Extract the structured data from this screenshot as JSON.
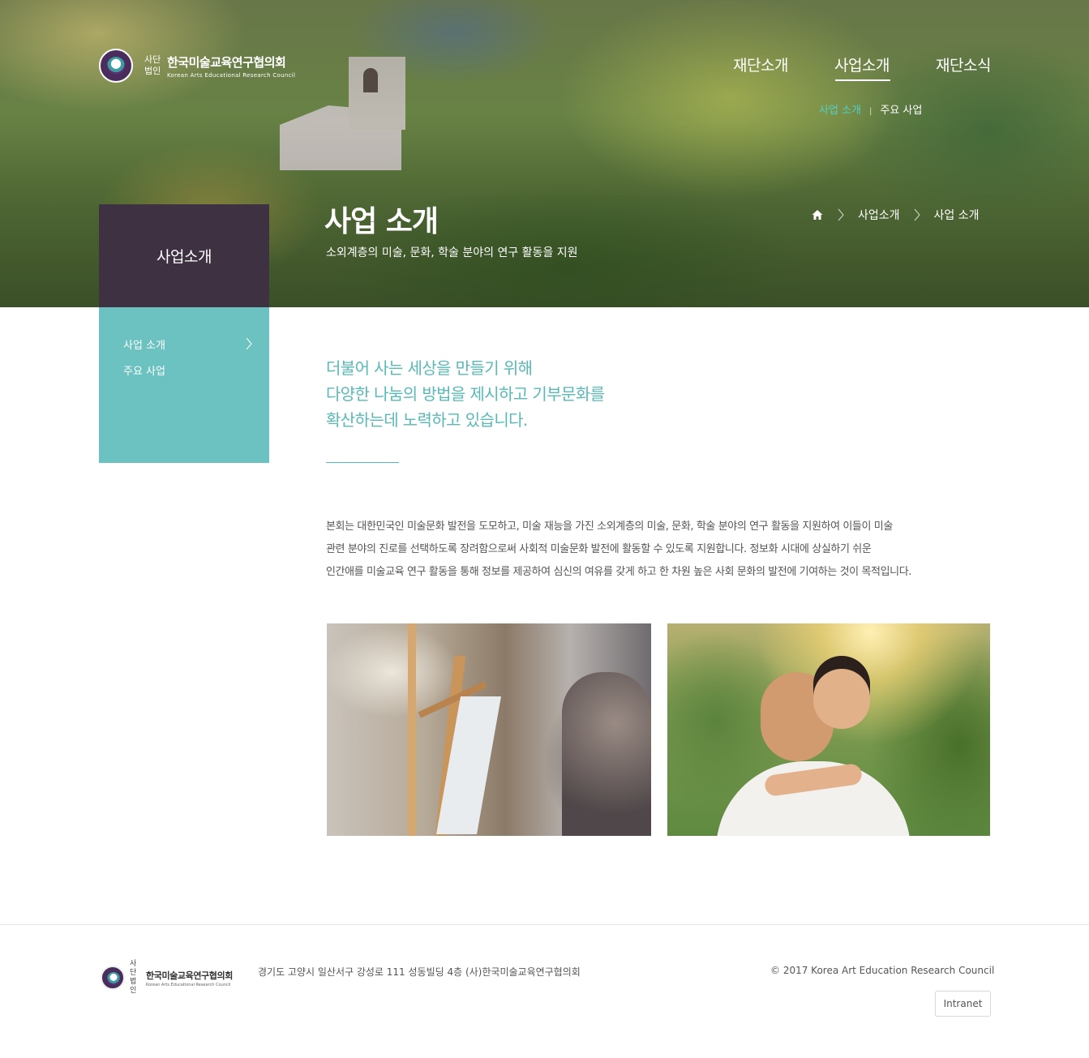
{
  "header": {
    "logo": {
      "small_label": "사단 법인",
      "name": "한국미술교육연구협의회",
      "english": "Korean Arts Educational Research Council"
    },
    "gnb": [
      {
        "label": "재단소개",
        "active": false
      },
      {
        "label": "사업소개",
        "active": true
      },
      {
        "label": "재단소식",
        "active": false
      }
    ],
    "subnav": [
      {
        "label": "사업 소개",
        "active": true
      },
      {
        "label": "주요 사업",
        "active": false
      }
    ]
  },
  "hero": {
    "title": "사업 소개",
    "subtitle": "소외계층의 미술, 문화, 학술 분야의 연구 활동을 지원",
    "breadcrumb": [
      "사업소개",
      "사업 소개"
    ]
  },
  "lnb": {
    "title": "사업소개",
    "items": [
      {
        "label": "사업 소개",
        "active": true
      },
      {
        "label": "주요 사업",
        "active": false
      }
    ]
  },
  "content": {
    "lead_lines": [
      "더불어 사는 세상을 만들기 위해",
      "다양한 나눔의 방법을 제시하고 기부문화를",
      "확산하는데 노력하고 있습니다."
    ],
    "body_lines": [
      "본회는 대한민국인 미술문화 발전을 도모하고, 미술 재능을 가진 소외계층의 미술, 문화, 학술 분야의 연구 활동을 지원하여 이들이 미술",
      "관련 분야의 진로를 선택하도록 장려함으로써 사회적 미술문화 발전에 활동할 수 있도록 지원합니다. 정보화 시대에 상실하기 쉬운",
      "인간애를 미술교육 연구 활동을 통해 정보를 제공하여 심신의 여유를 갖게 하고 한 차원 높은 사회 문화의 발전에 기여하는 것이 목적입니다."
    ]
  },
  "footer": {
    "logo": {
      "small_label": "사단 법인",
      "name": "한국미술교육연구협의회",
      "english": "Korean Arts Educational Research Council"
    },
    "address": "경기도 고양시 일산서구 강성로 111 성동빌딩 4층 (사)한국미술교육연구협의회",
    "copyright": "© 2017 Korea Art Education Research Council",
    "intranet_label": "Intranet"
  },
  "colors": {
    "accent": "#6cc2c0",
    "lnb_head": "#3d3142",
    "subnav_active": "#4fd1c9",
    "lead_text": "#58b9b6"
  }
}
